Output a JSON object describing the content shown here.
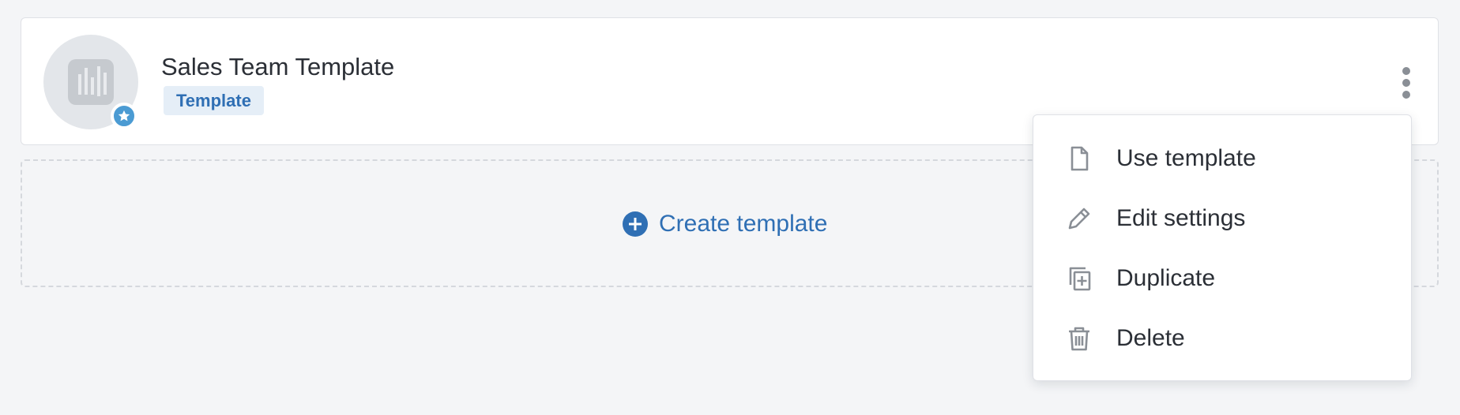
{
  "card": {
    "title": "Sales Team Template",
    "tag": "Template",
    "avatar_icon": "chart-bars-icon",
    "badge_icon": "star-icon",
    "more_icon": "kebab-menu-icon"
  },
  "create": {
    "label": "Create template",
    "icon": "plus-circle-icon"
  },
  "menu": {
    "items": [
      {
        "label": "Use template",
        "icon": "document-icon"
      },
      {
        "label": "Edit settings",
        "icon": "pencil-icon"
      },
      {
        "label": "Duplicate",
        "icon": "duplicate-icon"
      },
      {
        "label": "Delete",
        "icon": "trash-icon"
      }
    ]
  },
  "colors": {
    "accent": "#2f6fb4",
    "tag_bg": "#e5eef7",
    "badge": "#4b9bd3",
    "icon_gray": "#8a8f96"
  }
}
